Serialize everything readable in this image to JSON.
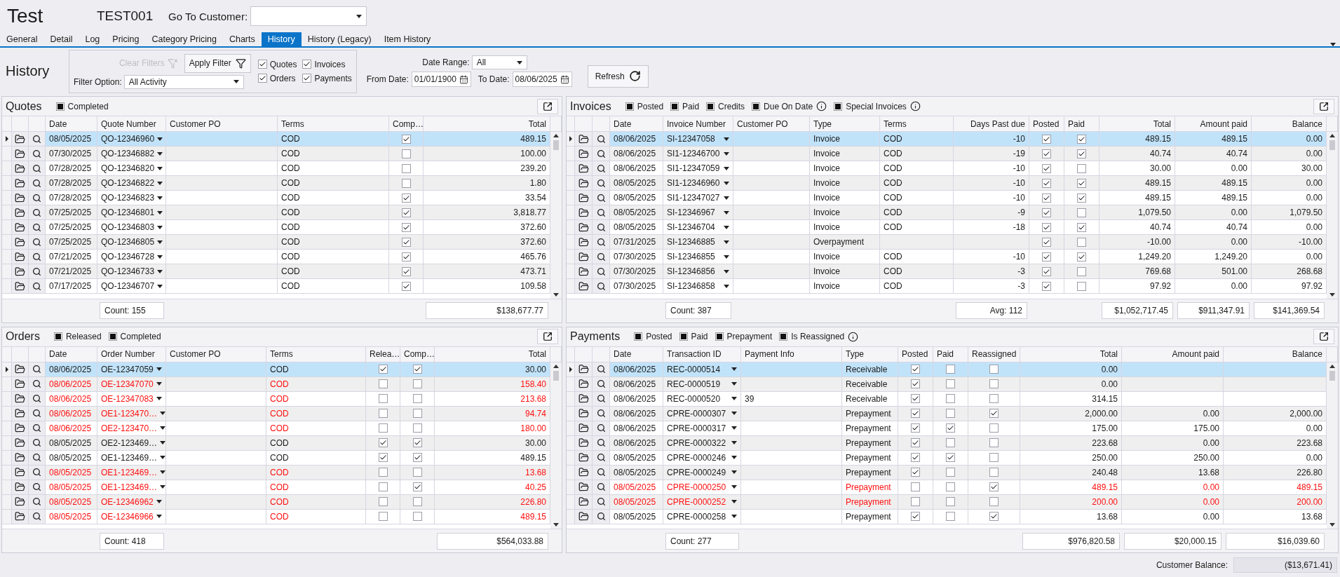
{
  "window": {
    "title": "Test",
    "customer_code": "TEST001"
  },
  "go_to_customer": {
    "label": "Go To Customer:"
  },
  "tabs": [
    {
      "label": "General",
      "selected": false
    },
    {
      "label": "Detail",
      "selected": false
    },
    {
      "label": "Log",
      "selected": false
    },
    {
      "label": "Pricing",
      "selected": false
    },
    {
      "label": "Category Pricing",
      "selected": false
    },
    {
      "label": "Charts",
      "selected": false
    },
    {
      "label": "History",
      "selected": true
    },
    {
      "label": "History (Legacy)",
      "selected": false
    },
    {
      "label": "Item History",
      "selected": false
    }
  ],
  "filter": {
    "title": "History",
    "clear_button": {
      "label": "Clear Filters",
      "disabled": true
    },
    "apply_button": {
      "label": "Apply Filter"
    },
    "filter_option": {
      "label": "Filter Option:",
      "value": "All Activity"
    },
    "types": [
      {
        "label": "Quotes",
        "checked": true
      },
      {
        "label": "Invoices",
        "checked": true
      },
      {
        "label": "Orders",
        "checked": true
      },
      {
        "label": "Payments",
        "checked": true
      }
    ],
    "date_range": {
      "label": "Date Range:",
      "value": "All"
    },
    "from_date": {
      "label": "From Date:",
      "value": "01/01/1900"
    },
    "to_date": {
      "label": "To Date:",
      "value": "08/06/2025"
    },
    "refresh_button": {
      "label": "Refresh"
    }
  },
  "panels": [
    {
      "kind": "quotes",
      "title": "Quotes",
      "legend": [
        {
          "label": "Completed"
        }
      ],
      "columns": [
        {
          "label": "Date",
          "kind": "text"
        },
        {
          "label": "Quote Number",
          "kind": "link",
          "summary": "Count: 155"
        },
        {
          "label": "Customer PO",
          "kind": "text"
        },
        {
          "label": "Terms",
          "kind": "text"
        },
        {
          "label": "Comp…",
          "kind": "check"
        },
        {
          "label": "Total",
          "kind": "number",
          "summary": "$138,677.77"
        }
      ],
      "rows": [
        {
          "selected": true,
          "flagged": false,
          "date": "08/05/2025",
          "number": "QO-12346960",
          "terms": "COD",
          "completed": true,
          "total": "489.15"
        },
        {
          "selected": false,
          "flagged": false,
          "date": "07/30/2025",
          "number": "QO-12346882",
          "terms": "COD",
          "completed": false,
          "total": "100.00"
        },
        {
          "selected": false,
          "flagged": false,
          "date": "07/28/2025",
          "number": "QO-12346820",
          "terms": "COD",
          "completed": false,
          "total": "239.20"
        },
        {
          "selected": false,
          "flagged": false,
          "date": "07/28/2025",
          "number": "QO-12346822",
          "terms": "COD",
          "completed": false,
          "total": "1.80"
        },
        {
          "selected": false,
          "flagged": false,
          "date": "07/28/2025",
          "number": "QO-12346823",
          "terms": "COD",
          "completed": true,
          "total": "33.54"
        },
        {
          "selected": false,
          "flagged": false,
          "date": "07/25/2025",
          "number": "QO-12346801",
          "terms": "COD",
          "completed": true,
          "total": "3,818.77"
        },
        {
          "selected": false,
          "flagged": false,
          "date": "07/25/2025",
          "number": "QO-12346803",
          "terms": "COD",
          "completed": true,
          "total": "372.60"
        },
        {
          "selected": false,
          "flagged": false,
          "date": "07/25/2025",
          "number": "QO-12346805",
          "terms": "COD",
          "completed": true,
          "total": "372.60"
        },
        {
          "selected": false,
          "flagged": false,
          "date": "07/21/2025",
          "number": "QO-12346728",
          "terms": "COD",
          "completed": true,
          "total": "465.76"
        },
        {
          "selected": false,
          "flagged": false,
          "date": "07/21/2025",
          "number": "QO-12346733",
          "terms": "COD",
          "completed": true,
          "total": "473.71"
        },
        {
          "selected": false,
          "flagged": false,
          "date": "07/17/2025",
          "number": "QO-12346707",
          "terms": "COD",
          "completed": true,
          "total": "109.58"
        }
      ]
    },
    {
      "kind": "invoices",
      "title": "Invoices",
      "legend": [
        {
          "label": "Posted"
        },
        {
          "label": "Paid"
        },
        {
          "label": "Credits"
        },
        {
          "label": "Due On Date",
          "info": true
        },
        {
          "label": "Special Invoices",
          "info": true
        }
      ],
      "columns": [
        {
          "label": "Date",
          "kind": "text"
        },
        {
          "label": "Invoice Number",
          "kind": "link",
          "summary": "Count: 387"
        },
        {
          "label": "Customer PO",
          "kind": "text"
        },
        {
          "label": "Type",
          "kind": "text"
        },
        {
          "label": "Terms",
          "kind": "text"
        },
        {
          "label": "Days Past due",
          "kind": "number",
          "summary": "Avg: 112"
        },
        {
          "label": "Posted",
          "kind": "check"
        },
        {
          "label": "Paid",
          "kind": "check"
        },
        {
          "label": "Total",
          "kind": "number",
          "summary": "$1,052,717.45"
        },
        {
          "label": "Amount paid",
          "kind": "number",
          "summary": "$911,347.91"
        },
        {
          "label": "Balance",
          "kind": "number",
          "summary": "$141,369.54"
        }
      ],
      "rows": [
        {
          "selected": true,
          "flagged": false,
          "date": "08/06/2025",
          "number": "SI-12347058",
          "type": "Invoice",
          "terms": "COD",
          "days": "-10",
          "posted": true,
          "paid": true,
          "total": "489.15",
          "amount_paid": "489.15",
          "balance": "0.00"
        },
        {
          "selected": false,
          "flagged": false,
          "date": "08/06/2025",
          "number": "SI1-12346700",
          "type": "Invoice",
          "terms": "COD",
          "days": "-19",
          "posted": true,
          "paid": true,
          "total": "40.74",
          "amount_paid": "40.74",
          "balance": "0.00"
        },
        {
          "selected": false,
          "flagged": false,
          "date": "08/06/2025",
          "number": "SI1-12347059",
          "type": "Invoice",
          "terms": "COD",
          "days": "-10",
          "posted": true,
          "paid": false,
          "total": "30.00",
          "amount_paid": "0.00",
          "balance": "30.00"
        },
        {
          "selected": false,
          "flagged": false,
          "date": "08/05/2025",
          "number": "SI1-12346960",
          "type": "Invoice",
          "terms": "COD",
          "days": "-10",
          "posted": true,
          "paid": true,
          "total": "489.15",
          "amount_paid": "489.15",
          "balance": "0.00"
        },
        {
          "selected": false,
          "flagged": false,
          "date": "08/05/2025",
          "number": "SI1-12347027",
          "type": "Invoice",
          "terms": "COD",
          "days": "-10",
          "posted": true,
          "paid": true,
          "total": "489.15",
          "amount_paid": "489.15",
          "balance": "0.00"
        },
        {
          "selected": false,
          "flagged": false,
          "date": "08/05/2025",
          "number": "SI-12346967",
          "type": "Invoice",
          "terms": "COD",
          "days": "-9",
          "posted": true,
          "paid": false,
          "total": "1,079.50",
          "amount_paid": "0.00",
          "balance": "1,079.50"
        },
        {
          "selected": false,
          "flagged": false,
          "date": "08/05/2025",
          "number": "SI-12346704",
          "type": "Invoice",
          "terms": "COD",
          "days": "-18",
          "posted": true,
          "paid": true,
          "total": "40.74",
          "amount_paid": "40.74",
          "balance": "0.00"
        },
        {
          "selected": false,
          "flagged": false,
          "date": "07/31/2025",
          "number": "SI-12346885",
          "type": "Overpayment",
          "posted": true,
          "paid": false,
          "total": "-10.00",
          "amount_paid": "0.00",
          "balance": "-10.00"
        },
        {
          "selected": false,
          "flagged": false,
          "date": "07/30/2025",
          "number": "SI-12346855",
          "type": "Invoice",
          "terms": "COD",
          "days": "-10",
          "posted": true,
          "paid": true,
          "total": "1,249.20",
          "amount_paid": "1,249.20",
          "balance": "0.00"
        },
        {
          "selected": false,
          "flagged": false,
          "date": "07/30/2025",
          "number": "SI-12346856",
          "type": "Invoice",
          "terms": "COD",
          "days": "-3",
          "posted": true,
          "paid": false,
          "total": "769.68",
          "amount_paid": "501.00",
          "balance": "268.68"
        },
        {
          "selected": false,
          "flagged": false,
          "date": "07/30/2025",
          "number": "SI-12346858",
          "type": "Invoice",
          "terms": "COD",
          "days": "-3",
          "posted": true,
          "paid": false,
          "total": "97.92",
          "amount_paid": "0.00",
          "balance": "97.92"
        }
      ]
    },
    {
      "kind": "orders",
      "title": "Orders",
      "legend": [
        {
          "label": "Released"
        },
        {
          "label": "Completed"
        }
      ],
      "columns": [
        {
          "label": "Date",
          "kind": "text"
        },
        {
          "label": "Order Number",
          "kind": "link",
          "summary": "Count: 418"
        },
        {
          "label": "Customer PO",
          "kind": "text"
        },
        {
          "label": "Terms",
          "kind": "text"
        },
        {
          "label": "Relea…",
          "kind": "check"
        },
        {
          "label": "Comp…",
          "kind": "check"
        },
        {
          "label": "Total",
          "kind": "number",
          "summary": "$564,033.88"
        }
      ],
      "rows": [
        {
          "selected": true,
          "flagged": false,
          "date": "08/06/2025",
          "number": "OE-12347059",
          "terms": "COD",
          "released": true,
          "completed": true,
          "total": "30.00"
        },
        {
          "selected": false,
          "flagged": true,
          "date": "08/06/2025",
          "number": "OE-12347070",
          "terms": "COD",
          "released": false,
          "completed": false,
          "total": "158.40"
        },
        {
          "selected": false,
          "flagged": true,
          "date": "08/06/2025",
          "number": "OE-12347083",
          "terms": "COD",
          "released": false,
          "completed": false,
          "total": "213.68"
        },
        {
          "selected": false,
          "flagged": true,
          "date": "08/06/2025",
          "number": "OE1-123470…",
          "terms": "COD",
          "released": false,
          "completed": false,
          "total": "94.74"
        },
        {
          "selected": false,
          "flagged": true,
          "date": "08/06/2025",
          "number": "OE2-123470…",
          "terms": "COD",
          "released": false,
          "completed": false,
          "total": "180.00"
        },
        {
          "selected": false,
          "flagged": false,
          "date": "08/05/2025",
          "number": "OE2-123469…",
          "terms": "COD",
          "released": true,
          "completed": true,
          "total": "30.00"
        },
        {
          "selected": false,
          "flagged": false,
          "date": "08/05/2025",
          "number": "OE1-123469…",
          "terms": "COD",
          "released": true,
          "completed": true,
          "total": "489.15"
        },
        {
          "selected": false,
          "flagged": true,
          "date": "08/05/2025",
          "number": "OE1-123469…",
          "terms": "COD",
          "released": false,
          "completed": false,
          "total": "13.68"
        },
        {
          "selected": false,
          "flagged": true,
          "date": "08/05/2025",
          "number": "OE1-123469…",
          "terms": "COD",
          "released": false,
          "completed": true,
          "total": "40.25"
        },
        {
          "selected": false,
          "flagged": true,
          "date": "08/05/2025",
          "number": "OE-12346962",
          "terms": "COD",
          "released": false,
          "completed": false,
          "total": "226.80"
        },
        {
          "selected": false,
          "flagged": true,
          "date": "08/05/2025",
          "number": "OE-12346966",
          "terms": "COD",
          "released": false,
          "completed": false,
          "total": "489.15"
        }
      ]
    },
    {
      "kind": "payments",
      "title": "Payments",
      "legend": [
        {
          "label": "Posted"
        },
        {
          "label": "Paid"
        },
        {
          "label": "Prepayment"
        },
        {
          "label": "Is Reassigned",
          "info": true
        }
      ],
      "columns": [
        {
          "label": "Date",
          "kind": "text"
        },
        {
          "label": "Transaction ID",
          "kind": "link",
          "summary": "Count: 277"
        },
        {
          "label": "Payment Info",
          "kind": "text"
        },
        {
          "label": "Type",
          "kind": "text"
        },
        {
          "label": "Posted",
          "kind": "check"
        },
        {
          "label": "Paid",
          "kind": "check"
        },
        {
          "label": "Reassigned",
          "kind": "check"
        },
        {
          "label": "Total",
          "kind": "number",
          "summary": "$976,820.58"
        },
        {
          "label": "Amount paid",
          "kind": "number",
          "summary": "$20,000.15"
        },
        {
          "label": "Balance",
          "kind": "number",
          "summary": "$16,039.60"
        }
      ],
      "rows": [
        {
          "selected": true,
          "flagged": false,
          "date": "08/06/2025",
          "number": "REC-0000514",
          "type": "Receivable",
          "posted": true,
          "paid": false,
          "reassigned": false,
          "total": "0.00"
        },
        {
          "selected": false,
          "flagged": false,
          "date": "08/06/2025",
          "number": "REC-0000519",
          "type": "Receivable",
          "posted": true,
          "paid": false,
          "reassigned": false,
          "total": "0.00"
        },
        {
          "selected": false,
          "flagged": false,
          "date": "08/06/2025",
          "number": "REC-0000520",
          "info": "39",
          "type": "Receivable",
          "posted": true,
          "paid": false,
          "reassigned": false,
          "total": "314.15"
        },
        {
          "selected": false,
          "flagged": false,
          "date": "08/06/2025",
          "number": "CPRE-0000307",
          "type": "Prepayment",
          "posted": true,
          "paid": false,
          "reassigned": true,
          "total": "2,000.00",
          "amount_paid": "0.00",
          "balance": "2,000.00"
        },
        {
          "selected": false,
          "flagged": false,
          "date": "08/06/2025",
          "number": "CPRE-0000317",
          "type": "Prepayment",
          "posted": true,
          "paid": true,
          "reassigned": false,
          "total": "175.00",
          "amount_paid": "175.00",
          "balance": "0.00"
        },
        {
          "selected": false,
          "flagged": false,
          "date": "08/06/2025",
          "number": "CPRE-0000322",
          "type": "Prepayment",
          "posted": true,
          "paid": false,
          "reassigned": false,
          "total": "223.68",
          "amount_paid": "0.00",
          "balance": "223.68"
        },
        {
          "selected": false,
          "flagged": false,
          "date": "08/05/2025",
          "number": "CPRE-0000246",
          "type": "Prepayment",
          "posted": true,
          "paid": true,
          "reassigned": false,
          "total": "250.00",
          "amount_paid": "250.00",
          "balance": "0.00"
        },
        {
          "selected": false,
          "flagged": false,
          "date": "08/05/2025",
          "number": "CPRE-0000249",
          "type": "Prepayment",
          "posted": true,
          "paid": false,
          "reassigned": false,
          "total": "240.48",
          "amount_paid": "13.68",
          "balance": "226.80"
        },
        {
          "selected": false,
          "flagged": true,
          "date": "08/05/2025",
          "number": "CPRE-0000250",
          "type": "Prepayment",
          "posted": false,
          "paid": false,
          "reassigned": true,
          "total": "489.15",
          "amount_paid": "0.00",
          "balance": "489.15"
        },
        {
          "selected": false,
          "flagged": true,
          "date": "08/05/2025",
          "number": "CPRE-0000252",
          "type": "Prepayment",
          "posted": false,
          "paid": false,
          "reassigned": false,
          "total": "200.00",
          "amount_paid": "0.00",
          "balance": "200.00"
        },
        {
          "selected": false,
          "flagged": false,
          "date": "08/05/2025",
          "number": "CPRE-0000258",
          "type": "Prepayment",
          "posted": true,
          "paid": false,
          "reassigned": true,
          "total": "13.68",
          "amount_paid": "0.00",
          "balance": "13.68"
        }
      ]
    }
  ],
  "status_bar": {
    "label": "Customer Balance:",
    "value": "($13,671.41)"
  }
}
